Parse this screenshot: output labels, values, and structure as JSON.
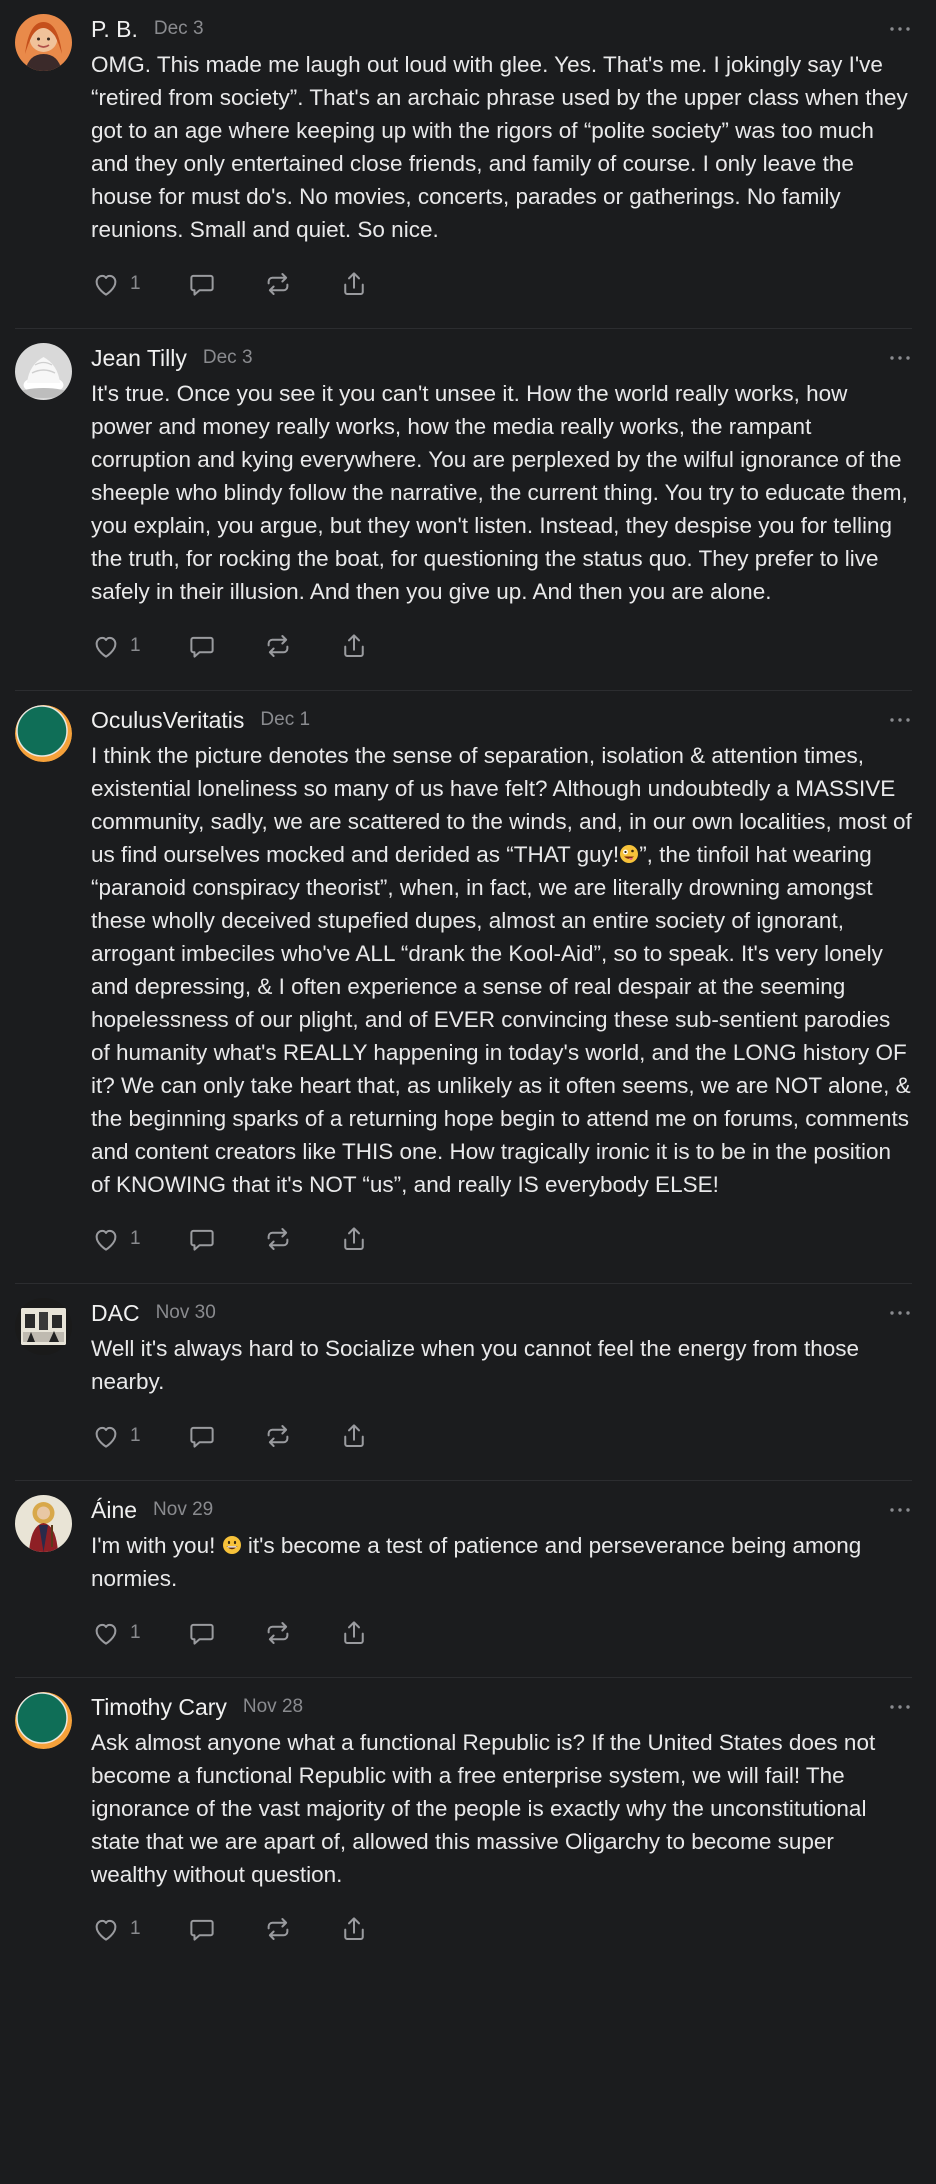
{
  "comments": [
    {
      "author": "P. B.",
      "date": "Dec 3",
      "text": "OMG. This made me laugh out loud with glee. Yes. That's me. I jokingly say I've “retired from society”. That's an archaic phrase used by the upper class when they got to an age where keeping up with the rigors of “polite society” was too much and they only entertained close friends, and family of course. I only leave the house for must do's. No movies, concerts, parades or gatherings. No family reunions. Small and quiet. So nice.",
      "likes": "1",
      "avatar": "portrait-red-hair"
    },
    {
      "author": "Jean Tilly",
      "date": "Dec 3",
      "text": "It's true. Once you see it you can't unsee it. How the world really works, how power and money really works, how the media really works, the rampant corruption and kying everywhere. You are perplexed by the wilful ignorance of the sheeple who blindy follow the narrative, the current thing. You try to educate them, you explain, you argue, but they won't listen. Instead, they despise you for telling the truth, for rocking the boat, for questioning the status quo. They prefer to live safely in their illusion. And then you give up. And then you are alone.",
      "likes": "1",
      "avatar": "white-cream"
    },
    {
      "author": "OculusVeritatis",
      "date": "Dec 1",
      "text_before": "I think the picture denotes the sense of separation, isolation & attention times, existential loneliness so many of us have felt? Although undoubtedly a MASSIVE community, sadly, we are scattered to the winds, and, in our own localities, most of us find ourselves mocked and derided as “THAT guy!",
      "text_after": "”, the tinfoil hat wearing “paranoid conspiracy theorist”, when, in fact, we are literally drowning amongst these wholly deceived stupefied dupes, almost an entire society of ignorant, arrogant imbeciles who've ALL “drank the Kool-Aid”, so to speak. It's very lonely and depressing, & I often experience a sense of real despair at the seeming hopelessness of our plight, and of EVER convincing these sub-sentient parodies of humanity what's REALLY happening in today's world, and the LONG history OF it? We can only take heart that, as unlikely as it often seems, we are NOT alone, & the beginning sparks of a returning hope begin to attend me on forums, comments and content creators like THIS one. How tragically ironic it is to be in the position of KNOWING that it's NOT “us”, and really IS everybody ELSE!",
      "emoji": "zany-face-emoji",
      "likes": "1",
      "avatar": "default-green-orange"
    },
    {
      "author": "DAC",
      "date": "Nov 30",
      "text": "Well it's always hard to Socialize when you cannot feel the energy from those nearby.",
      "likes": "1",
      "avatar": "black-white-photo"
    },
    {
      "author": "Áine",
      "date": "Nov 29",
      "text_before": "I'm with you! ",
      "text_after": " it's become a test of patience and perseverance being among normies.",
      "emoji": "grinning-face-emoji",
      "likes": "1",
      "avatar": "saint-icon-painting"
    },
    {
      "author": "Timothy Cary",
      "date": "Nov 28",
      "text": "Ask almost anyone what a functional Republic is? If the United States does not become a functional Republic with a free enterprise system, we will fail! The ignorance of the vast majority of the people is exactly why the unconstitutional state that we are apart of, allowed this massive Oligarchy to become super wealthy without question.",
      "likes": "1",
      "avatar": "default-green-orange"
    }
  ],
  "colors": {
    "background": "#1b1c1e",
    "divider": "#2c2d30",
    "text": "#e9e9ea",
    "muted": "#8a8b8f",
    "icon": "#9a9b9f"
  }
}
